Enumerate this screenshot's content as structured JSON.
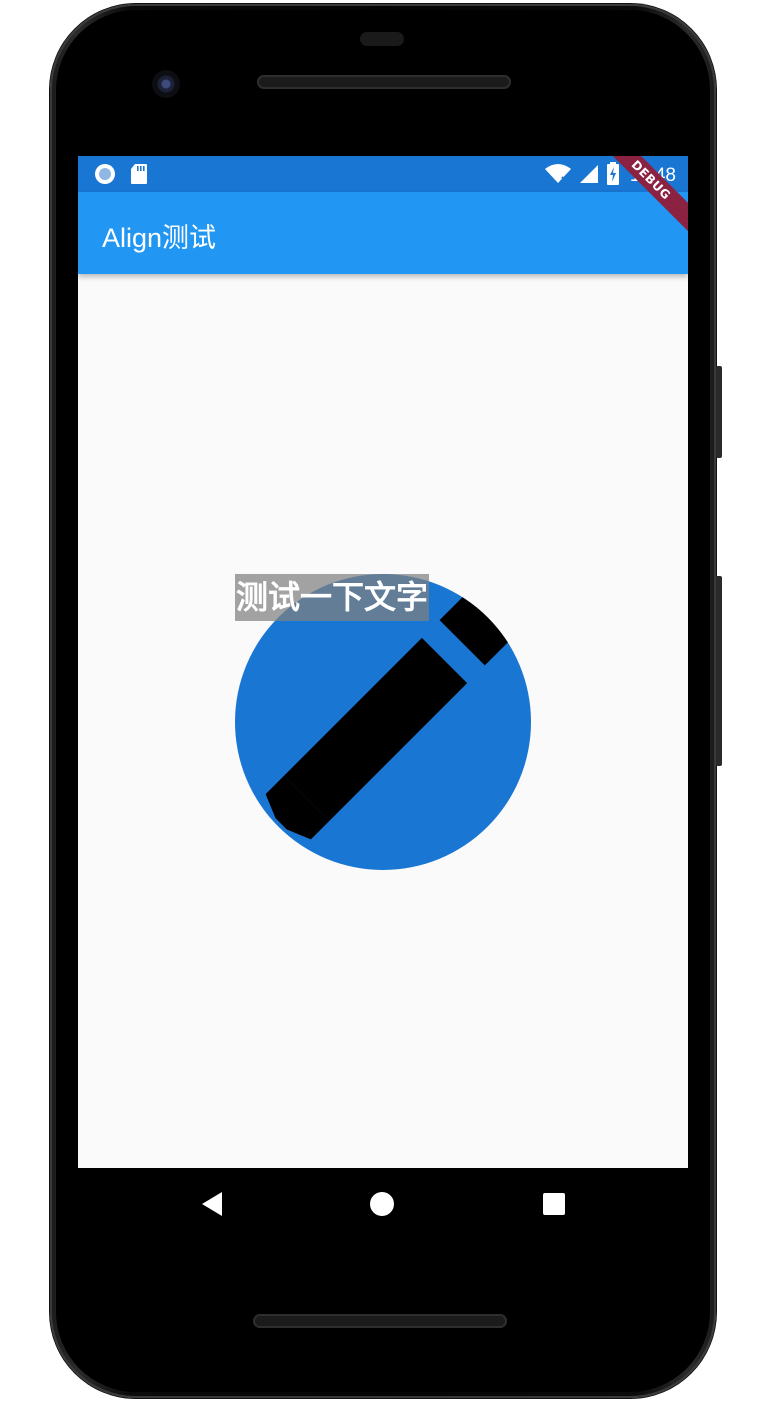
{
  "status_bar": {
    "time": "11:48",
    "left_icons": [
      "record-icon",
      "sd-card-icon"
    ],
    "right_icons": [
      "wifi-icon",
      "signal-icon",
      "battery-charging-icon"
    ]
  },
  "app_bar": {
    "title": "Align测试"
  },
  "debug_banner": {
    "label": "DEBUG"
  },
  "content": {
    "overlay_text": "测试一下文字",
    "circle_icon": "edit-pencil-icon"
  },
  "nav_bar": {
    "buttons": [
      "back-icon",
      "home-icon",
      "recents-icon"
    ]
  },
  "colors": {
    "status_bar": "#1976d2",
    "app_bar": "#2196f3",
    "circle": "#1976d2",
    "background": "#fafafa",
    "debug_banner": "#8b2242"
  }
}
